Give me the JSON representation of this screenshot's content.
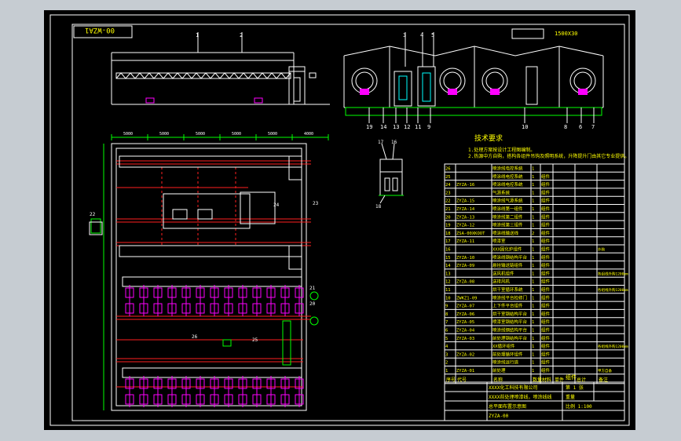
{
  "drawing": {
    "sheet_code": "00-WZA1",
    "scale_label": "1500X30",
    "notes_title": "技术要求",
    "notes": [
      "1.处理方案按设计工程图编制。",
      "2.热源中方自购，搭构各组件吊钩及照明系统，升降提升门由其它专业提供。"
    ],
    "callouts": [
      "1",
      "2",
      "3",
      "4",
      "5",
      "6",
      "7",
      "8",
      "9",
      "10",
      "11",
      "12",
      "13",
      "14",
      "15",
      "16",
      "17",
      "18",
      "19",
      "20",
      "21",
      "22",
      "23",
      "24",
      "25",
      "26"
    ],
    "bom_header": [
      "序号",
      "代号",
      "名称",
      "数量",
      "材料",
      "单件",
      "总计",
      "备注"
    ],
    "bom_rows": [
      {
        "no": "26",
        "code": "",
        "name": "喷涂线电控系统",
        "qty": "1",
        "mat": "",
        "note": ""
      },
      {
        "no": "25",
        "code": "",
        "name": "喷涂线电控系统",
        "qty": "1",
        "mat": "组件",
        "note": ""
      },
      {
        "no": "24",
        "code": "ZYZA-16",
        "name": "喷涂线电控系统",
        "qty": "1",
        "mat": "组件",
        "note": ""
      },
      {
        "no": "23",
        "code": "",
        "name": "气源系统",
        "qty": "1",
        "mat": "组件",
        "note": ""
      },
      {
        "no": "22",
        "code": "ZYZA-15",
        "name": "喷涂线气源系统",
        "qty": "1",
        "mat": "组件",
        "note": ""
      },
      {
        "no": "21",
        "code": "ZYZA-14",
        "name": "喷涂线第一组件",
        "qty": "1",
        "mat": "组件",
        "note": ""
      },
      {
        "no": "20",
        "code": "ZYZA-13",
        "name": "喷涂线第二组件",
        "qty": "1",
        "mat": "组件",
        "note": ""
      },
      {
        "no": "19",
        "code": "ZYZA-12",
        "name": "喷涂线第三组件",
        "qty": "1",
        "mat": "组件",
        "note": ""
      },
      {
        "no": "18",
        "code": "ZSA-00XKOOT",
        "name": "喷涂线输送线",
        "qty": "2",
        "mat": "组件",
        "note": ""
      },
      {
        "no": "17",
        "code": "ZYZA-11",
        "name": "喷漆室",
        "qty": "1",
        "mat": "组件",
        "note": ""
      },
      {
        "no": "16",
        "code": "",
        "name": "XXX固化炉组件",
        "qty": "1",
        "mat": "组件",
        "note": "外购"
      },
      {
        "no": "15",
        "code": "ZYZA-10",
        "name": "喷涂线钢结构平台",
        "qty": "1",
        "mat": "组件",
        "note": ""
      },
      {
        "no": "14",
        "code": "ZYZA-09",
        "name": "悬挂输送链组件",
        "qty": "1",
        "mat": "组件",
        "note": ""
      },
      {
        "no": "13",
        "code": "",
        "name": "送风机组件",
        "qty": "1",
        "mat": "组件",
        "note": "各组线外购1200mm"
      },
      {
        "no": "12",
        "code": "ZYZA-08",
        "name": "送排风机",
        "qty": "1",
        "mat": "组件",
        "note": ""
      },
      {
        "no": "11",
        "code": "",
        "name": "烘干室循环系统",
        "qty": "1",
        "mat": "组件",
        "note": "各组线外购1200mm"
      },
      {
        "no": "10",
        "code": "ZWKZ1-09",
        "name": "喷涂线平台检修门",
        "qty": "1",
        "mat": "组件",
        "note": ""
      },
      {
        "no": "9",
        "code": "ZYZA-07",
        "name": "上下件平台组件",
        "qty": "1",
        "mat": "组件",
        "note": ""
      },
      {
        "no": "8",
        "code": "ZYZA-06",
        "name": "烘干室钢结构平台",
        "qty": "1",
        "mat": "组件",
        "note": ""
      },
      {
        "no": "7",
        "code": "ZYZA-05",
        "name": "喷漆室钢结构平台",
        "qty": "1",
        "mat": "组件",
        "note": ""
      },
      {
        "no": "6",
        "code": "ZYZA-04",
        "name": "喷涂线钢结构平台",
        "qty": "1",
        "mat": "组件",
        "note": ""
      },
      {
        "no": "5",
        "code": "ZYZA-03",
        "name": "前处理钢结构平台",
        "qty": "1",
        "mat": "组件",
        "note": ""
      },
      {
        "no": "4",
        "code": "",
        "name": "XX循环组件",
        "qty": "1",
        "mat": "组件",
        "note": "各组线外购1200mm"
      },
      {
        "no": "3",
        "code": "ZYZA-02",
        "name": "前处理循环组件",
        "qty": "1",
        "mat": "组件",
        "note": ""
      },
      {
        "no": "2",
        "code": "",
        "name": "喷涂线运行道",
        "qty": "1",
        "mat": "组件",
        "note": ""
      },
      {
        "no": "1",
        "code": "ZYZA-01",
        "name": "前处理",
        "qty": "1",
        "mat": "组件",
        "note": "甲方自备"
      }
    ],
    "title_block": {
      "company": "XXXX化工科技有限公司",
      "project": "XXXX前处理喷漆线，喷涂线线",
      "drawing_name": "总平面布置示意图",
      "drawing_no": "ZYZA-00",
      "assembly": "组件",
      "sheets": "第 1 张",
      "scale": "比例 1:100",
      "weight": "重量"
    },
    "dimensions_top": [
      "5000",
      "5000",
      "5000",
      "5000",
      "5000",
      "4000"
    ]
  }
}
